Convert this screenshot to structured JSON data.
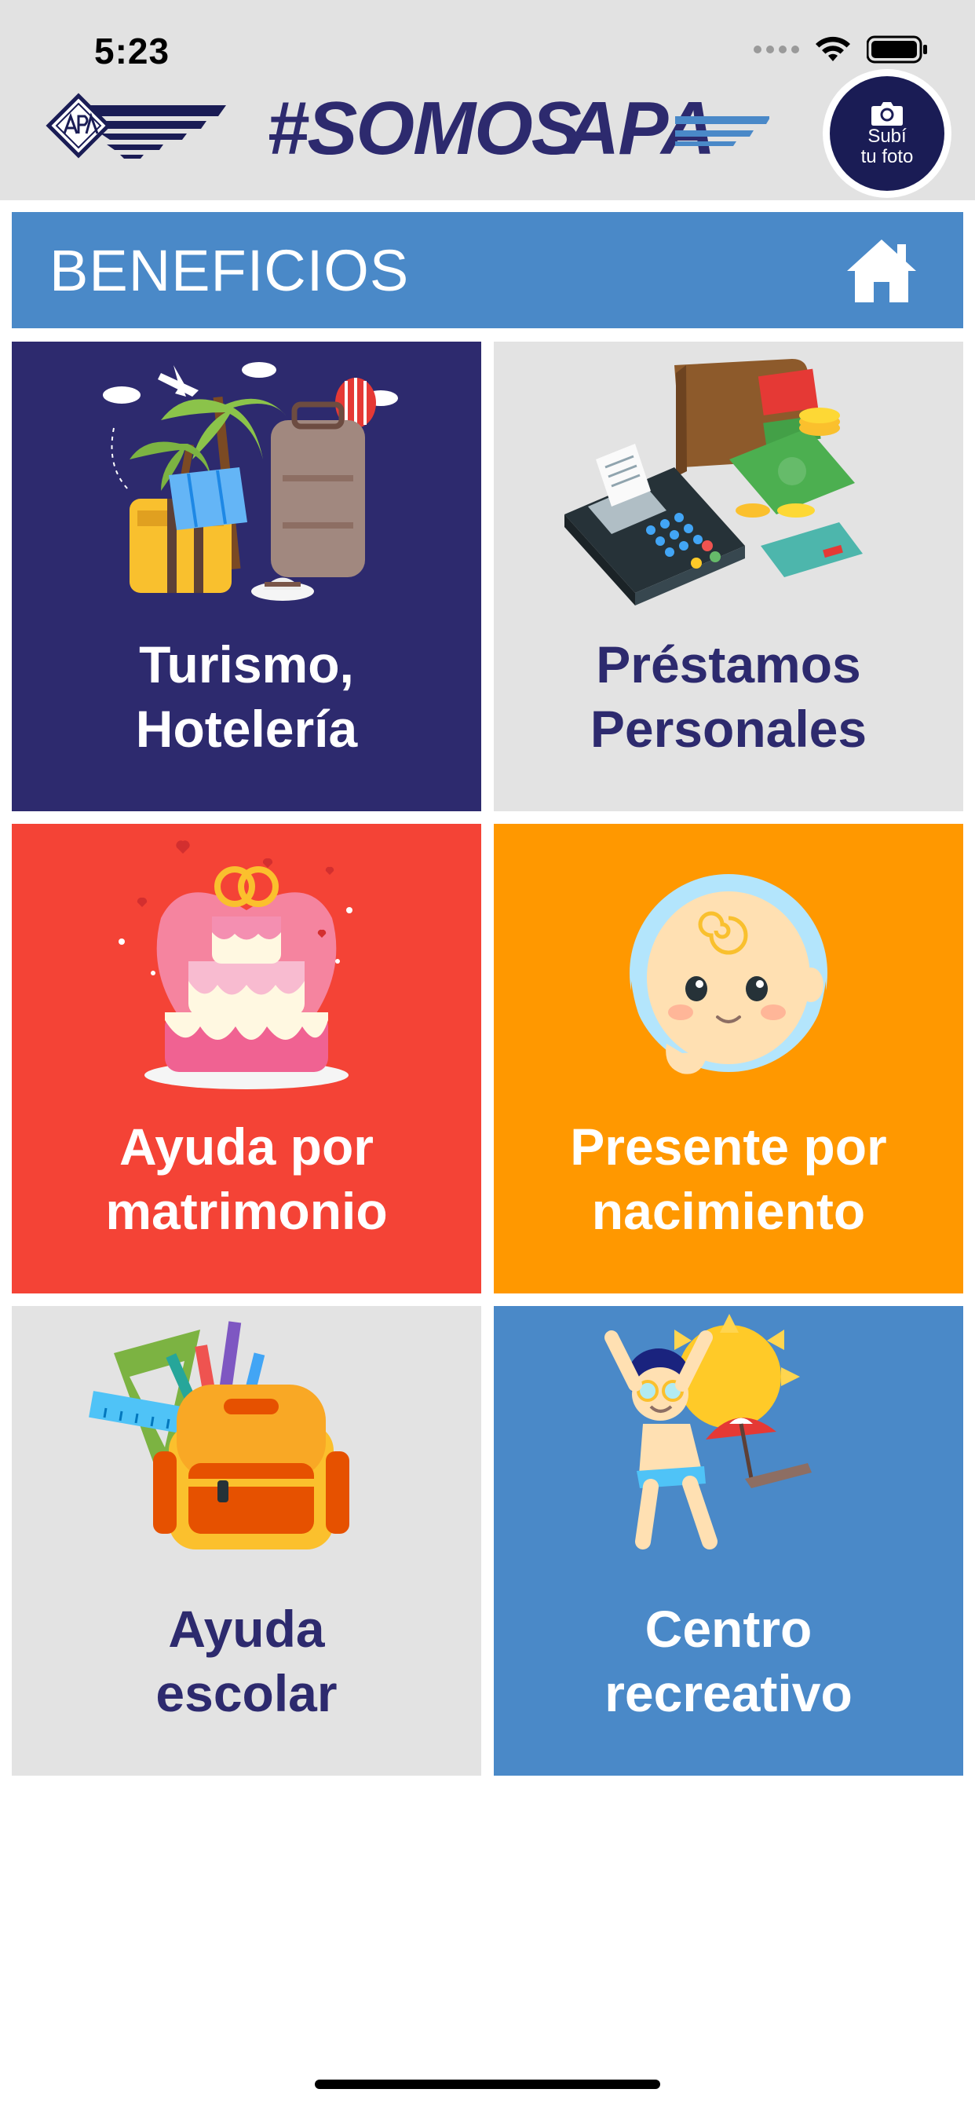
{
  "status_bar": {
    "time": "5:23"
  },
  "header": {
    "photo_button": {
      "line1": "Subí",
      "line2": "tu foto"
    }
  },
  "section": {
    "title": "BENEFICIOS"
  },
  "tiles": [
    {
      "line1": "Turismo,",
      "line2": "Hotelería",
      "bg": "#2d2a6e",
      "color": "#ffffff"
    },
    {
      "line1": "Préstamos",
      "line2": "Personales",
      "bg": "#e3e3e3",
      "color": "#2d2a6e"
    },
    {
      "line1": "Ayuda por",
      "line2": "matrimonio",
      "bg": "#f44336",
      "color": "#ffffff"
    },
    {
      "line1": "Presente por",
      "line2": "nacimiento",
      "bg": "#ff9800",
      "color": "#ffffff"
    },
    {
      "line1": "Ayuda",
      "line2": "escolar",
      "bg": "#e3e3e3",
      "color": "#2d2a6e"
    },
    {
      "line1": "Centro",
      "line2": "recreativo",
      "bg": "#4a89c8",
      "color": "#ffffff"
    }
  ],
  "colors": {
    "accent": "#4a89c8",
    "navy": "#2d2a6e",
    "header_bg": "#e2e2e2"
  },
  "icons": [
    "wifi-icon",
    "battery-icon",
    "camera-icon",
    "home-icon"
  ]
}
